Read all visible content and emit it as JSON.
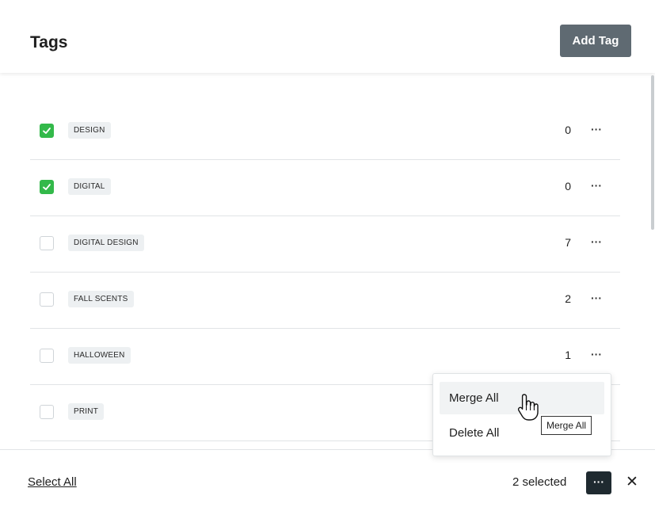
{
  "header": {
    "title": "Tags",
    "add_button": "Add Tag"
  },
  "rows": [
    {
      "label": "DESIGN",
      "count": "0",
      "checked": true,
      "more": "···"
    },
    {
      "label": "DIGITAL",
      "count": "0",
      "checked": true,
      "more": "···"
    },
    {
      "label": "DIGITAL DESIGN",
      "count": "7",
      "checked": false,
      "more": "···"
    },
    {
      "label": "FALL SCENTS",
      "count": "2",
      "checked": false,
      "more": "···"
    },
    {
      "label": "HALLOWEEN",
      "count": "1",
      "checked": false,
      "more": "···"
    },
    {
      "label": "PRINT",
      "count": "",
      "checked": false,
      "more": ""
    }
  ],
  "footer": {
    "select_all": "Select All",
    "selected_count": "2 selected",
    "more": "···",
    "close": "✕"
  },
  "menu": {
    "merge_all": "Merge All",
    "delete_all": "Delete All"
  },
  "tooltip": "Merge All",
  "colors": {
    "checkbox_checked": "#33b94a",
    "add_button_bg": "#5f6a72",
    "footer_more_bg": "#1f2a30"
  }
}
